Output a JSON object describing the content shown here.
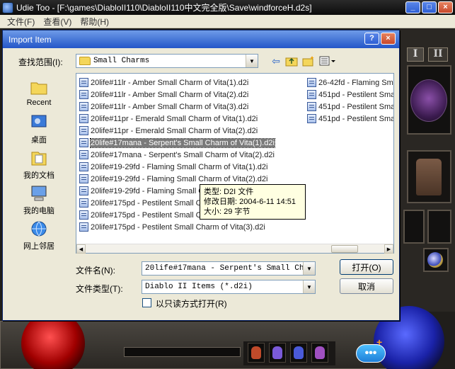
{
  "app": {
    "title": "Udie Too - [F:\\games\\DiabloII110\\DiabloII110中文完全版\\Save\\windforceH.d2s]",
    "menu": [
      "文件(F)",
      "查看(V)",
      "帮助(H)"
    ]
  },
  "dialog": {
    "title": "Import Item",
    "look_in_label": "查找范围(I):",
    "look_in_value": "Small Charms",
    "places": [
      {
        "label": "Recent",
        "icon": "recent-folder-icon"
      },
      {
        "label": "桌面",
        "icon": "desktop-icon"
      },
      {
        "label": "我的文档",
        "icon": "my-documents-icon"
      },
      {
        "label": "我的电脑",
        "icon": "my-computer-icon"
      },
      {
        "label": "网上邻居",
        "icon": "network-places-icon"
      }
    ],
    "files_col1": [
      "20life#11lr - Amber Small Charm of Vita(1).d2i",
      "20life#11lr - Amber Small Charm of Vita(2).d2i",
      "20life#11lr - Amber Small Charm of Vita(3).d2i",
      "20life#11pr - Emerald Small Charm of Vita(1).d2i",
      "20life#11pr - Emerald Small Charm of Vita(2).d2i",
      "20life#17mana - Serpent's Small Charm of Vita(1).d2i",
      "20life#17mana - Serpent's Small Charm of Vita(2).d2i",
      "20life#19-29fd - Flaming Small Charm of Vita(1).d2i",
      "20life#19-29fd - Flaming Small Charm of Vita(2).d2i",
      "20life#19-29fd - Flaming Small Charm of Vita(3).d2i",
      "20life#175pd - Pestilent Small Charm of Vita(1).d2i",
      "20life#175pd - Pestilent Small Charm of Vita(2).d2i",
      "20life#175pd - Pestilent Small Charm of Vita(3).d2i"
    ],
    "files_col2": [
      "26-42fd - Flaming Sma",
      "451pd - Pestilent Sma",
      "451pd - Pestilent Sma",
      "451pd - Pestilent Sma"
    ],
    "selected_index": 5,
    "tooltip": {
      "type": "类型: D2I 文件",
      "modified": "修改日期: 2004-6-11 14:51",
      "size": "大小: 29 字节"
    },
    "filename_label": "文件名(N):",
    "filename_value": "20life#17mana - Serpent's Small Charm",
    "filetype_label": "文件类型(T):",
    "filetype_value": "Diablo II Items (*.d2i)",
    "readonly_label": "以只读方式打开(R)",
    "open_button": "打开(O)",
    "cancel_button": "取消"
  },
  "game": {
    "tab1": "I",
    "tab2": "II"
  }
}
